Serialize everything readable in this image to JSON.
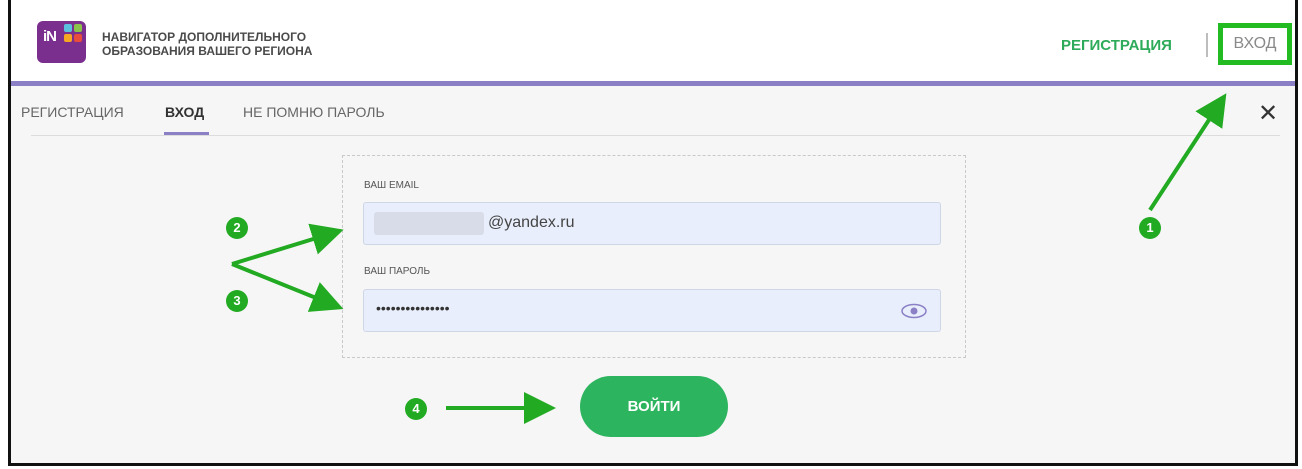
{
  "header": {
    "brand_line1": "НАВИГАТОР ДОПОЛНИТЕЛЬНОГО",
    "brand_line2": "ОБРАЗОВАНИЯ ВАШЕГО РЕГИОНА",
    "logo_text": "iN",
    "register_label": "РЕГИСТРАЦИЯ",
    "login_label": "ВХОД"
  },
  "tabs": [
    {
      "label": "РЕГИСТРАЦИЯ",
      "active": false
    },
    {
      "label": "ВХОД",
      "active": true
    },
    {
      "label": "НЕ ПОМНЮ ПАРОЛЬ",
      "active": false
    }
  ],
  "close_symbol": "✕",
  "form": {
    "email_label": "ВАШ EMAIL",
    "email_value": "@yandex.ru",
    "password_label": "ВАШ ПАРОЛЬ",
    "password_value": "•••••••••••••••",
    "show_password_icon": "eye-icon",
    "submit_label": "ВОЙТИ"
  },
  "annotations": {
    "marker_1": "1",
    "marker_2": "2",
    "marker_3": "3",
    "marker_4": "4"
  },
  "colors": {
    "accent_green": "#2db45e",
    "annotation_green": "#22aa22",
    "accent_purple": "#8b80c6",
    "logo_purple": "#7a2f8f"
  }
}
